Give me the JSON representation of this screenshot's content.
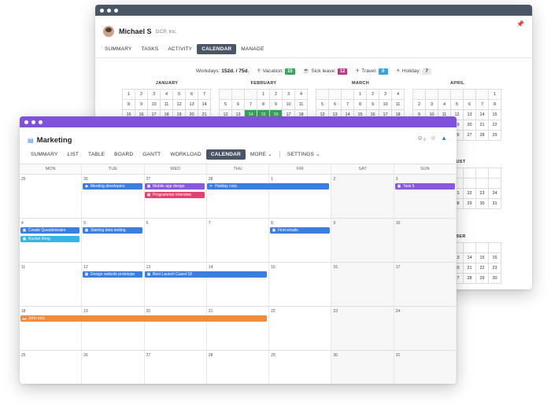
{
  "back": {
    "user_name": "Michael S",
    "company": "GCP, Inc.",
    "tabs": [
      "SUMMARY",
      "TASKS",
      "ACTIVITY",
      "CALENDAR",
      "MANAGE"
    ],
    "active_tab": "CALENDAR",
    "stats": {
      "workdays_label": "Workdays:",
      "workdays_value": "152d. / 75d.",
      "vacation_label": "Vacation:",
      "vacation_value": "15",
      "sick_label": "Sick leave:",
      "sick_value": "12",
      "travel_label": "Travel:",
      "travel_value": "0",
      "holiday_label": "Holiday:",
      "holiday_value": "7"
    },
    "months": [
      "JANUARY",
      "FEBRUARY",
      "MARCH",
      "APRIL"
    ],
    "side_months": [
      "UGUST",
      "EMBER"
    ],
    "colors": {
      "vacation": "#3aa55c",
      "sick": "#c2338a",
      "travel": "#35a7e0",
      "holiday": "#e8e8e8"
    }
  },
  "front": {
    "title": "Marketing",
    "tabs": [
      "SUMMARY",
      "LIST",
      "TABLE",
      "BOARD",
      "GANTT",
      "WORKLOAD",
      "CALENDAR",
      "MORE",
      "SETTINGS"
    ],
    "active_tab": "CALENDAR",
    "weekdays": [
      "MON",
      "TUE",
      "WED",
      "THU",
      "FRI",
      "SAT",
      "SUN"
    ],
    "weeks": [
      [
        "25",
        "26",
        "27",
        "28",
        "1",
        "2",
        "3"
      ],
      [
        "4",
        "5",
        "6",
        "7",
        "8",
        "9",
        "10"
      ],
      [
        "11",
        "12",
        "13",
        "14",
        "15",
        "16",
        "17"
      ],
      [
        "18",
        "19",
        "20",
        "21",
        "22",
        "23",
        "24"
      ],
      [
        "25",
        "26",
        "27",
        "28",
        "29",
        "30",
        "31"
      ]
    ],
    "events": {
      "meeting_developers": "Meeting developers",
      "mobile_app_design": "Mobile app design",
      "holiday_corp": "Holiday corp.",
      "task_5": "Task 5",
      "programmer_interview": "Programmer interview",
      "create_questionnaire": "Create Questionnaire",
      "starting_beta_testing": "Starting beta testing",
      "find_emails": "Find emails",
      "rocket_firing": "Rocket firing",
      "design_website_prototype": "Design website prototype",
      "best_launch_cases": "Best Launch Cases'18",
      "john_sick": "John sick"
    }
  }
}
